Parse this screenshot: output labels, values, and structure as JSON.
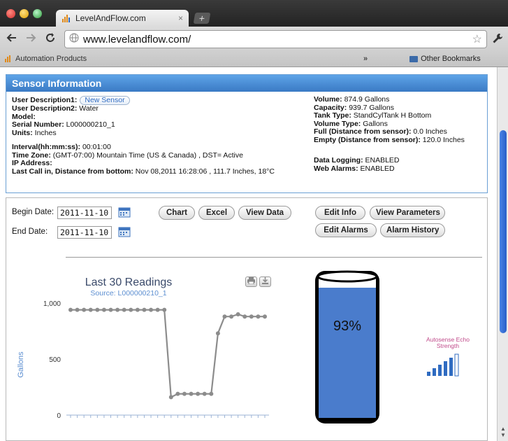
{
  "browser": {
    "tab_title": "LevelAndFlow.com",
    "tab_close": "×",
    "new_tab": "+",
    "url": "www.levelandflow.com/",
    "bookmark_left": "Automation Products",
    "bookmark_chevron": "»",
    "bookmark_right": "Other Bookmarks",
    "icons": {
      "back": "arrow-left-icon",
      "forward": "arrow-right-icon",
      "reload": "reload-icon",
      "site": "globe-icon",
      "bookmark_star": "star-icon",
      "menu": "wrench-icon",
      "bookmarks_folder": "folder-icon"
    }
  },
  "sensor": {
    "header": "Sensor Information",
    "left": {
      "desc1_label": "User Description1:",
      "new_sensor_btn": "New Sensor",
      "desc2_label": "User Description2:",
      "desc2_value": "Water",
      "model_label": "Model:",
      "serial_label": "Serial Number:",
      "serial_value": "L000000210_1",
      "units_label": "Units:",
      "units_value": "Inches",
      "interval_label": "Interval(hh:mm:ss):",
      "interval_value": "00:01:00",
      "tz_label": "Time Zone:",
      "tz_value": "(GMT-07:00) Mountain Time (US & Canada) , DST= Active",
      "ip_label": "IP Address:",
      "lastcall_label": "Last Call in, Distance from bottom:",
      "lastcall_value": "Nov 08,2011 16:28:06 , 111.7 Inches, 18°C"
    },
    "right": {
      "volume_label": "Volume:",
      "volume_value": "874.9 Gallons",
      "capacity_label": "Capacity:",
      "capacity_value": "939.7 Gallons",
      "tanktype_label": "Tank Type:",
      "tanktype_value": "StandCylTank H Bottom",
      "voltype_label": "Volume Type:",
      "voltype_value": "Gallons",
      "full_label": "Full (Distance from sensor):",
      "full_value": "0.0 Inches",
      "empty_label": "Empty (Distance from sensor):",
      "empty_value": "120.0 Inches",
      "logging_label": "Data Logging:",
      "logging_value": "ENABLED",
      "alarms_label": "Web Alarms:",
      "alarms_value": "ENABLED"
    }
  },
  "controls": {
    "begin_label": "Begin Date:",
    "begin_value": "2011-11-10",
    "end_label": "End Date:",
    "end_value": "2011-11-10",
    "buttons": {
      "chart": "Chart",
      "excel": "Excel",
      "view_data": "View Data",
      "edit_info": "Edit Info",
      "view_parameters": "View Parameters",
      "edit_alarms": "Edit Alarms",
      "alarm_history": "Alarm History"
    },
    "chart_buttons": {
      "print": "print-icon",
      "download": "download-icon"
    }
  },
  "tank": {
    "level_fraction": 0.93,
    "label": "93%",
    "fill_color": "#4a7ccc",
    "echo_label": "Autosense Echo Strength",
    "echo_bars_filled": 5,
    "echo_bars_total": 6,
    "echo_color": "#2f6bc1"
  },
  "chart_data": {
    "type": "line",
    "title": "Last 30 Readings",
    "subtitle": "Source: L000000210_1",
    "xlabel": "",
    "ylabel": "Gallons",
    "ylim": [
      0,
      1000
    ],
    "yticks": [
      0,
      500,
      1000
    ],
    "ytick_labels": [
      "0",
      "500",
      "1,000"
    ],
    "grid": false,
    "legend": "none",
    "line_color": "#8c8c8c",
    "series": [
      {
        "values": [
          940,
          940,
          940,
          940,
          940,
          940,
          940,
          940,
          940,
          940,
          940,
          940,
          940,
          940,
          940,
          160,
          190,
          190,
          190,
          190,
          190,
          190,
          730,
          880,
          880,
          900,
          880,
          880,
          880,
          880
        ]
      }
    ]
  }
}
